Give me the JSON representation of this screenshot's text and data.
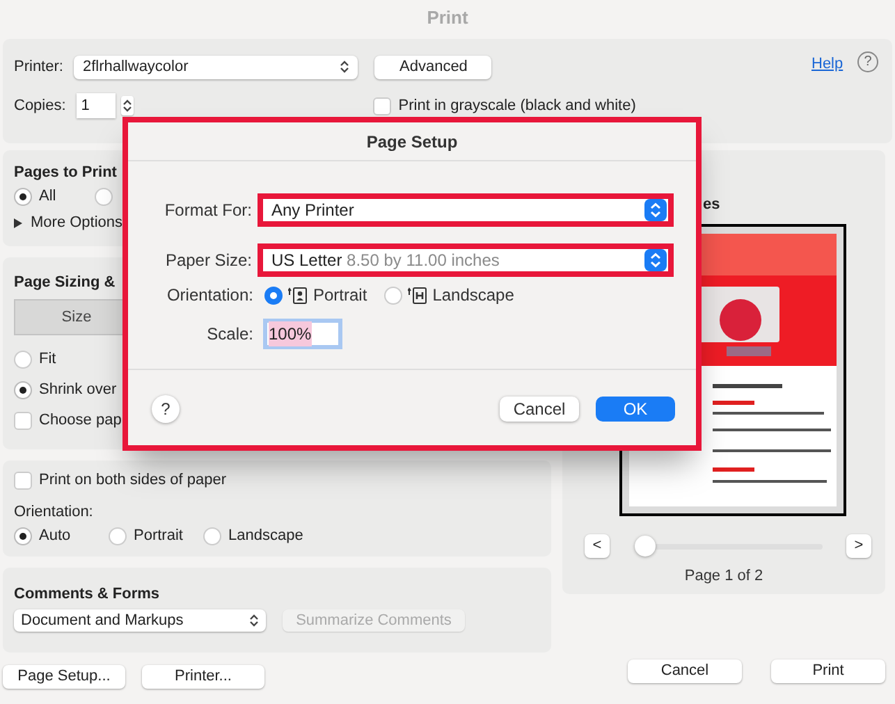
{
  "window": {
    "title": "Print"
  },
  "printer": {
    "label": "Printer:",
    "value": "2flrhallwaycolor"
  },
  "advanced_button": "Advanced",
  "help_link": "Help",
  "help_button": "?",
  "copies": {
    "label": "Copies:",
    "value": "1"
  },
  "grayscale": {
    "label": "Print in grayscale (black and white)",
    "checked": false
  },
  "pages_to_print": {
    "title": "Pages to Print",
    "options": [
      {
        "label": "All",
        "selected": true
      },
      {
        "selected": false
      }
    ],
    "more_options": "More Options"
  },
  "page_sizing": {
    "title": "Page Sizing &",
    "tabs": [
      {
        "label": "Size",
        "selected": true
      }
    ],
    "options": [
      {
        "kind": "radio",
        "label": "Fit",
        "selected": false
      },
      {
        "kind": "radio",
        "label": "Shrink over",
        "selected": true
      },
      {
        "kind": "checkbox",
        "label": "Choose pap",
        "checked": false
      }
    ]
  },
  "duplex": {
    "label": "Print on both sides of paper",
    "checked": false
  },
  "orientation": {
    "label": "Orientation:",
    "options": [
      {
        "label": "Auto",
        "selected": true
      },
      {
        "label": "Portrait",
        "selected": false
      },
      {
        "label": "Landscape",
        "selected": false
      }
    ]
  },
  "comments_forms": {
    "title": "Comments & Forms",
    "select": "Document and Markups",
    "summarize_button": {
      "label": "Summarize Comments",
      "disabled": true
    }
  },
  "preview": {
    "title": "es",
    "prev": "<",
    "next": ">",
    "slider": {
      "level": 0
    },
    "page_label": "Page 1 of 2"
  },
  "footer_buttons": [
    {
      "label": "Page Setup..."
    },
    {
      "label": "Printer..."
    }
  ],
  "action_buttons": [
    {
      "label": "Cancel"
    },
    {
      "label": "Print"
    }
  ],
  "page_setup": {
    "title": "Page Setup",
    "format_for": {
      "label": "Format For:",
      "value": "Any Printer"
    },
    "paper_size": {
      "label": "Paper Size:",
      "value": "US Letter",
      "detail": "8.50 by 11.00 inches"
    },
    "orientation": {
      "label": "Orientation:",
      "options": [
        {
          "label": "Portrait",
          "selected": true
        },
        {
          "label": "Landscape",
          "selected": false
        }
      ]
    },
    "scale": {
      "label": "Scale:",
      "value": "100%"
    },
    "help": "?",
    "buttons": [
      {
        "label": "Cancel",
        "default": false
      },
      {
        "label": "OK",
        "default": true
      }
    ]
  }
}
